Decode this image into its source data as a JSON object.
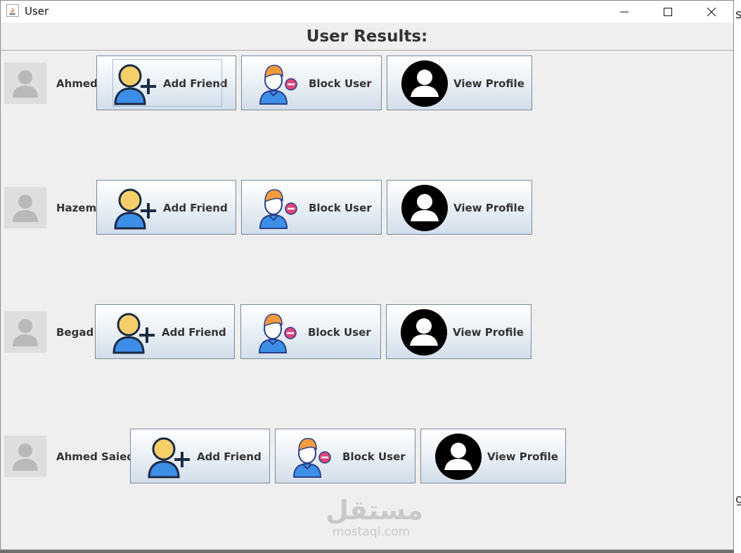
{
  "window": {
    "title": "User"
  },
  "header": {
    "title": "User Results:"
  },
  "buttons": {
    "add_friend": "Add Friend",
    "block_user": "Block User",
    "view_profile": "View Profile"
  },
  "users": [
    {
      "name": "Ahmed"
    },
    {
      "name": "Hazem"
    },
    {
      "name": "Begad"
    },
    {
      "name": "Ahmed Saied"
    }
  ],
  "watermark": {
    "arabic": "مستقل",
    "latin": "mostaql.com"
  },
  "background_window": {
    "glyph_top": "s",
    "glyph_bottom": "g"
  },
  "icons": {
    "add_friend": "add-friend-icon",
    "block_user": "block-user-icon",
    "view_profile": "profile-icon",
    "avatar": "avatar-placeholder-icon"
  },
  "colors": {
    "person_yellow": "#f6cf6b",
    "person_blue": "#3d8ee6",
    "hair_orange": "#f39b3c",
    "block_badge": "#e0457a",
    "button_gradient_bottom": "#d2deea"
  }
}
